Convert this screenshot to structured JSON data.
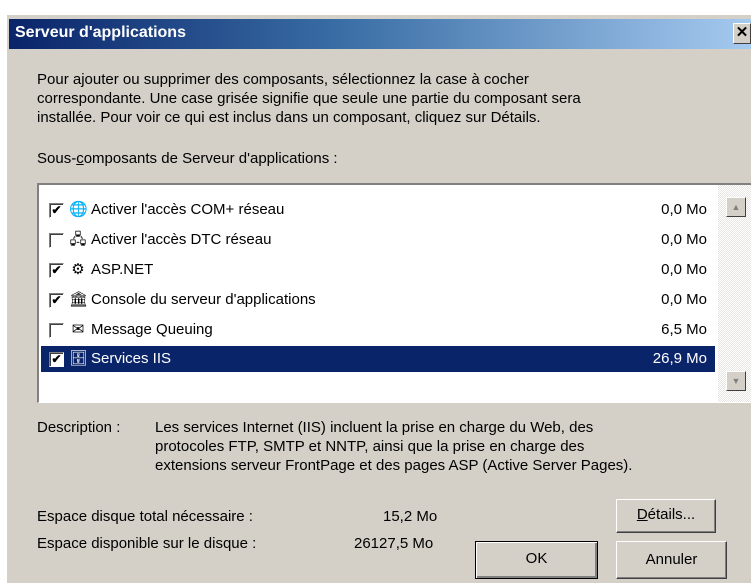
{
  "dialog": {
    "title": "Serveur d'applications",
    "close_glyph": "✕"
  },
  "intro": {
    "line1": "Pour ajouter ou supprimer des composants, sélectionnez la case à cocher",
    "line2": "correspondante. Une case grisée signifie que seule une partie du composant sera",
    "line3": "installée. Pour voir ce qui est inclus dans un composant, cliquez sur Détails."
  },
  "subcomponents_label": {
    "before": "Sous-",
    "underlined": "c",
    "after": "omposants de Serveur d'applications :"
  },
  "components": [
    {
      "label": "Activer l'accès COM+ réseau",
      "size": "0,0 Mo",
      "checked": true,
      "selected": false,
      "icon": "com-network-icon"
    },
    {
      "label": "Activer l'accès DTC réseau",
      "size": "0,0 Mo",
      "checked": false,
      "selected": false,
      "icon": "dtc-network-icon"
    },
    {
      "label": "ASP.NET",
      "size": "0,0 Mo",
      "checked": true,
      "selected": false,
      "icon": "aspnet-gears-icon"
    },
    {
      "label": "Console du serveur d'applications",
      "size": "0,0 Mo",
      "checked": true,
      "selected": false,
      "icon": "app-server-console-icon"
    },
    {
      "label": "Message Queuing",
      "size": "6,5 Mo",
      "checked": false,
      "selected": false,
      "icon": "message-queuing-icon"
    },
    {
      "label": "Services IIS",
      "size": "26,9 Mo",
      "checked": true,
      "selected": true,
      "icon": "iis-services-icon"
    }
  ],
  "description": {
    "label": "Description :",
    "line1": "Les services Internet (IIS) incluent la prise en charge du Web, des",
    "line2": "protocoles FTP, SMTP et NNTP, ainsi que la prise en charge des",
    "line3": "extensions serveur FrontPage et des pages ASP (Active Server Pages)."
  },
  "disk": {
    "required_label": "Espace disque total nécessaire :",
    "required_value": "15,2 Mo",
    "available_label": "Espace disponible sur le disque :",
    "available_value": "26127,5 Mo"
  },
  "buttons": {
    "details_underlined": "D",
    "details_rest": "étails...",
    "ok": "OK",
    "cancel": "Annuler"
  },
  "colors": {
    "selection": "#0a246a",
    "face": "#d4d0c8"
  }
}
